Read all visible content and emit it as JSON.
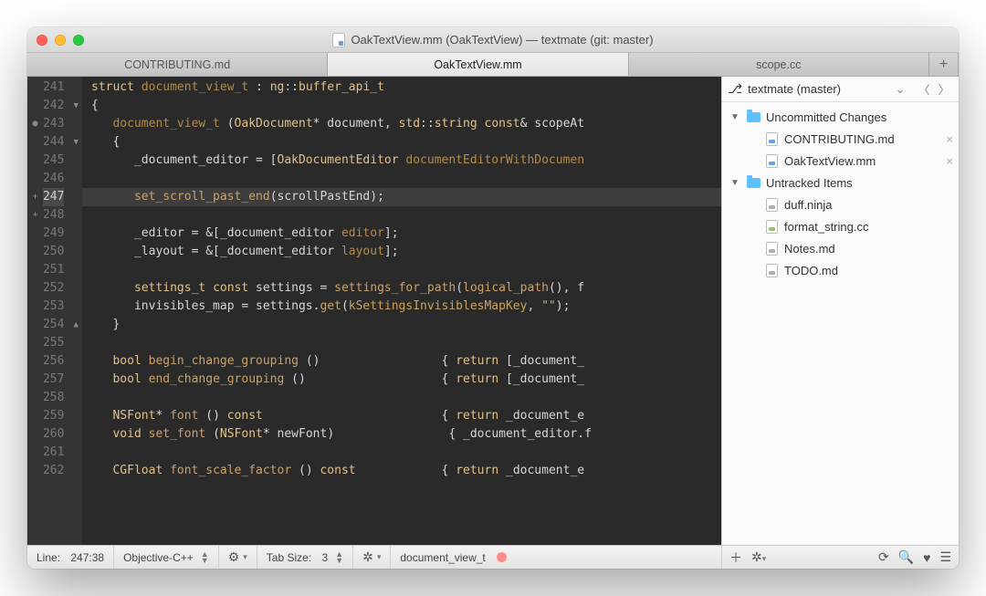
{
  "window": {
    "title": "OakTextView.mm (OakTextView) — textmate (git: master)"
  },
  "tabs": [
    {
      "label": "CONTRIBUTING.md",
      "active": false
    },
    {
      "label": "OakTextView.mm",
      "active": true
    },
    {
      "label": "scope.cc",
      "active": false
    }
  ],
  "newtab_glyph": "+",
  "gutter": {
    "start": 241,
    "count": 22,
    "current": 247,
    "folds": {
      "242": "▼",
      "244": "▼",
      "254": "▲"
    },
    "marks": {
      "243": "●",
      "247": "+",
      "248": "+"
    }
  },
  "code": {
    "lines": [
      {
        "n": 241,
        "h": "<span class='kw'>struct</span> <span class='id'>document_view_t</span> : <span class='ty'>ng</span>::<span class='ty'>buffer_api_t</span>"
      },
      {
        "n": 242,
        "h": "{"
      },
      {
        "n": 243,
        "h": "   <span class='id'>document_view_t</span> (<span class='ty'>OakDocument</span>* document, <span class='ty'>std</span>::<span class='ty'>string</span> <span class='kw'>const</span>&amp; scopeAt"
      },
      {
        "n": 244,
        "h": "   {"
      },
      {
        "n": 245,
        "h": "      _document_editor = [<span class='ty'>OakDocumentEditor</span> <span class='mc'>documentEditorWithDocumen</span>"
      },
      {
        "n": 246,
        "h": ""
      },
      {
        "n": 247,
        "h": "      <span class='fn'>set_scroll_past_end</span>(scrollPastEnd);",
        "current": true
      },
      {
        "n": 248,
        "h": ""
      },
      {
        "n": 249,
        "h": "      _editor = &amp;[_document_editor <span class='mc'>editor</span>];"
      },
      {
        "n": 250,
        "h": "      _layout = &amp;[_document_editor <span class='mc'>layout</span>];"
      },
      {
        "n": 251,
        "h": ""
      },
      {
        "n": 252,
        "h": "      <span class='ty'>settings_t</span> <span class='kw'>const</span> settings = <span class='fn'>settings_for_path</span>(<span class='fn'>logical_path</span>(), f"
      },
      {
        "n": 253,
        "h": "      invisibles_map = settings.<span class='fn'>get</span>(<span class='id2'>kSettingsInvisiblesMapKey</span>, <span class='st'>\"\"</span>);"
      },
      {
        "n": 254,
        "h": "   }"
      },
      {
        "n": 255,
        "h": ""
      },
      {
        "n": 256,
        "h": "   <span class='kw'>bool</span> <span class='fn'>begin_change_grouping</span> ()                 { <span class='kw'>return</span> [_document_"
      },
      {
        "n": 257,
        "h": "   <span class='kw'>bool</span> <span class='fn'>end_change_grouping</span> ()                   { <span class='kw'>return</span> [_document_"
      },
      {
        "n": 258,
        "h": ""
      },
      {
        "n": 259,
        "h": "   <span class='ty'>NSFont</span>* <span class='fn'>font</span> () <span class='kw'>const</span>                         { <span class='kw'>return</span> _document_e"
      },
      {
        "n": 260,
        "h": "   <span class='kw'>void</span> <span class='fn'>set_font</span> (<span class='ty'>NSFont</span>* newFont)                { _document_editor.f"
      },
      {
        "n": 261,
        "h": ""
      },
      {
        "n": 262,
        "h": "   <span class='ty'>CGFloat</span> <span class='fn'>font_scale_factor</span> () <span class='kw'>const</span>            { <span class='kw'>return</span> _document_e"
      }
    ]
  },
  "sidebar": {
    "header": {
      "name": "textmate (master)"
    },
    "sections": [
      {
        "label": "Uncommitted Changes",
        "items": [
          {
            "label": "CONTRIBUTING.md",
            "kind": "file",
            "discard": true
          },
          {
            "label": "OakTextView.mm",
            "kind": "file",
            "discard": true
          }
        ]
      },
      {
        "label": "Untracked Items",
        "items": [
          {
            "label": "duff.ninja",
            "kind": "txt"
          },
          {
            "label": "format_string.cc",
            "kind": "cc"
          },
          {
            "label": "Notes.md",
            "kind": "txt"
          },
          {
            "label": "TODO.md",
            "kind": "txt"
          }
        ]
      }
    ]
  },
  "status": {
    "line_label": "Line:",
    "position": "247:38",
    "language": "Objective-C++",
    "tabsize_label": "Tab Size:",
    "tabsize_value": "3",
    "symbol": "document_view_t"
  }
}
